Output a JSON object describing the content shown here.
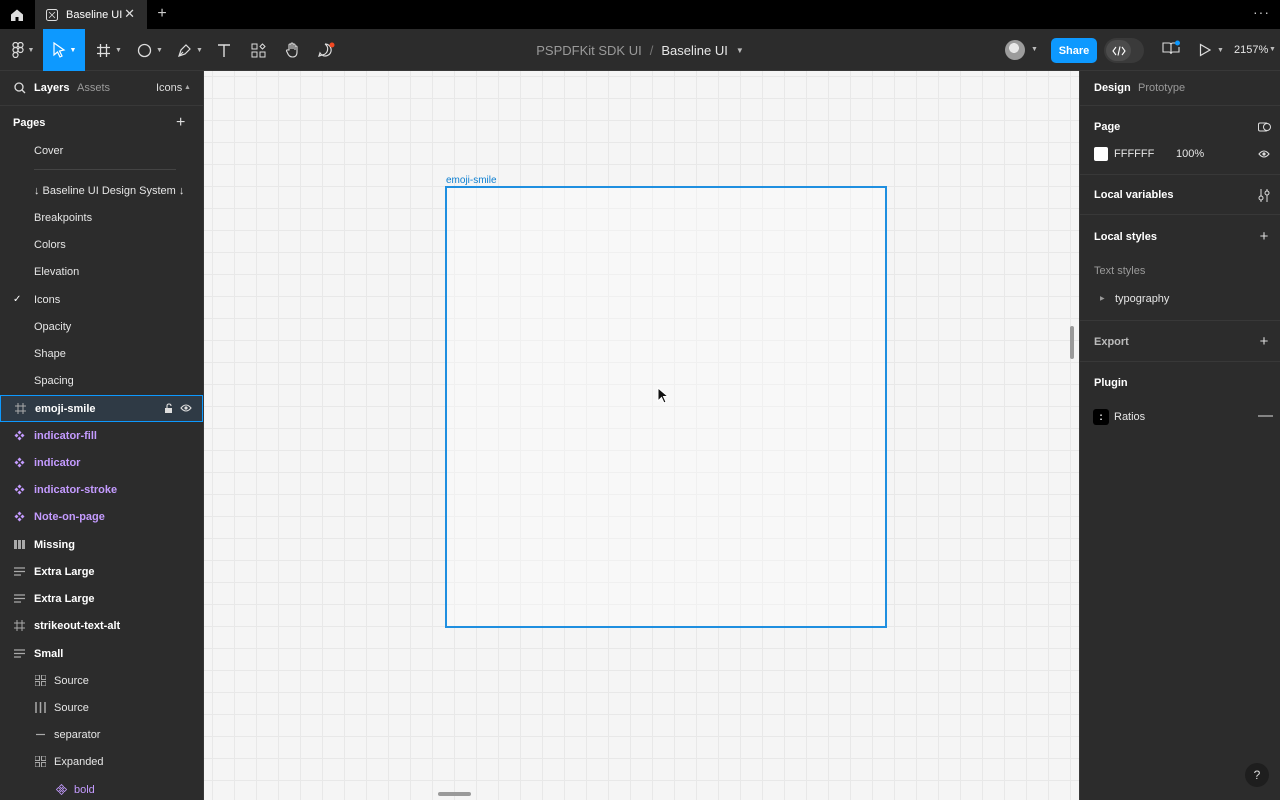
{
  "titlebar": {
    "tab_label": "Baseline UI",
    "tab_close": "✕",
    "new_tab": "+",
    "more": "···"
  },
  "toolbar": {
    "project_name": "PSPDFKit SDK UI",
    "separator": "/",
    "file_name": "Baseline UI",
    "share_label": "Share",
    "zoom_label": "2157%",
    "accent_color": "#0d99ff"
  },
  "left_panel": {
    "tabs": {
      "layers": "Layers",
      "assets": "Assets",
      "page_switch": "Icons"
    },
    "pages_header": "Pages",
    "add_page": "+",
    "pages": [
      {
        "label": "Cover",
        "checked": false
      },
      {
        "label": "↓ Baseline UI Design System ↓",
        "checked": false
      },
      {
        "label": "Breakpoints",
        "checked": false
      },
      {
        "label": "Colors",
        "checked": false
      },
      {
        "label": "Elevation",
        "checked": false
      },
      {
        "label": "Icons",
        "checked": true
      },
      {
        "label": "Opacity",
        "checked": false
      },
      {
        "label": "Shape",
        "checked": false
      },
      {
        "label": "Spacing",
        "checked": false
      }
    ],
    "check_mark": "✓",
    "layers": [
      {
        "label": "emoji-smile",
        "icon": "frame-icon",
        "selected": true
      },
      {
        "label": "indicator-fill",
        "icon": "component-icon"
      },
      {
        "label": "indicator",
        "icon": "component-icon"
      },
      {
        "label": "indicator-stroke",
        "icon": "component-icon"
      },
      {
        "label": "Note-on-page",
        "icon": "component-icon"
      },
      {
        "label": "Missing",
        "icon": "grid-icon"
      },
      {
        "label": "Extra Large",
        "icon": "text-lines-icon"
      },
      {
        "label": "Extra Large",
        "icon": "text-lines-icon"
      },
      {
        "label": "strikeout-text-alt",
        "icon": "frame-icon"
      },
      {
        "label": "Small",
        "icon": "text-lines-icon"
      },
      {
        "label": "Source",
        "icon": "grid-icon"
      },
      {
        "label": "Source",
        "icon": "columns-icon"
      },
      {
        "label": "separator",
        "icon": "line-icon"
      },
      {
        "label": "Expanded",
        "icon": "grid-icon"
      },
      {
        "label": "bold",
        "icon": "component-icon"
      }
    ]
  },
  "canvas": {
    "frame_label": "emoji-smile",
    "background": "#f5f5f5",
    "frame_color": "#1f8fe0"
  },
  "right_panel": {
    "tabs": {
      "design": "Design",
      "prototype": "Prototype"
    },
    "page_section": {
      "title": "Page",
      "hex": "FFFFFF",
      "opacity": "100%"
    },
    "local_variables": "Local variables",
    "local_styles": "Local styles",
    "text_styles": "Text styles",
    "typography": "typography",
    "export": "Export",
    "plugin": "Plugin",
    "plugin_name": "Ratios",
    "plugin_icon": ":",
    "help": "?"
  }
}
